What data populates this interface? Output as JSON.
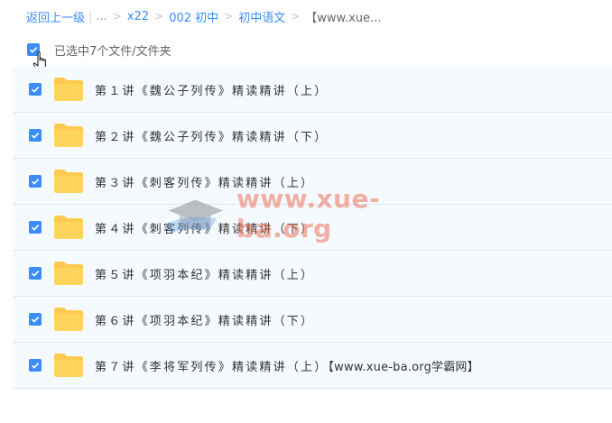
{
  "breadcrumb": {
    "back": "返回上一级",
    "ellipsis": "...",
    "items": [
      "x22",
      "002 初中",
      "初中语文"
    ],
    "current": "【www.xue..."
  },
  "selection": {
    "text": "已选中7个文件/文件夹"
  },
  "files": [
    {
      "name": "第１讲《魏公子列传》精读精讲（上）",
      "tag": ""
    },
    {
      "name": "第２讲《魏公子列传》精读精讲（下）",
      "tag": ""
    },
    {
      "name": "第３讲《刺客列传》精读精讲（上）",
      "tag": ""
    },
    {
      "name": "第４讲《刺客列传》精读精讲（下）",
      "tag": ""
    },
    {
      "name": "第５讲《项羽本纪》精读精讲（上）",
      "tag": ""
    },
    {
      "name": "第６讲《项羽本纪》精读精讲（下）",
      "tag": ""
    },
    {
      "name": "第７讲《李将军列传》精读精讲（上）",
      "tag": "【www.xue-ba.org学霸网】"
    }
  ],
  "watermark": {
    "text": "www.xue-ba.org"
  },
  "colors": {
    "accent": "#3b8cff",
    "folder": "#ffc94d",
    "rowBg": "#f5fafe"
  }
}
